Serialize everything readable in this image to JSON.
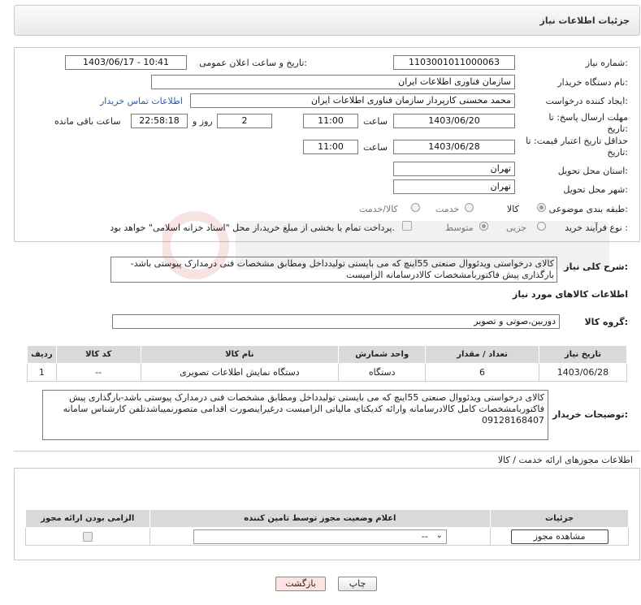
{
  "header": {
    "title": "جزئیات اطلاعات نیاز"
  },
  "form": {
    "need_number_label": "شماره نیاز:",
    "need_number": "1103001011000063",
    "announce_label": "تاریخ و ساعت اعلان عمومی:",
    "announce_value": "1403/06/17 - 10:41",
    "buyer_label": "نام دستگاه خریدار:",
    "buyer_value": "سازمان فناوری اطلاعات ایران",
    "creator_label": "ایجاد کننده درخواست:",
    "creator_value": "محمد محسنی کارپرداز سازمان فناوری اطلاعات ایران",
    "contact_link": "اطلاعات تماس خریدار",
    "deadline_label_1": "مهلت ارسال پاسخ: تا",
    "deadline_label_2": "تاریخ:",
    "deadline_date": "1403/06/20",
    "hour_label": "ساعت",
    "deadline_time": "11:00",
    "days_value": "2",
    "days_label": "روز و",
    "remaining_time": "22:58:18",
    "remaining_label": "ساعت باقی مانده",
    "validity_label_1": "حداقل تاریخ اعتبار قیمت: تا",
    "validity_label_2": "تاریخ:",
    "validity_date": "1403/06/28",
    "validity_time": "11:00",
    "province_label": "استان محل تحویل:",
    "province_value": "تهران",
    "city_label": "شهر محل تحویل:",
    "city_value": "تهران",
    "category_label": "طبقه بندی موضوعی:",
    "category_options": [
      "کالا",
      "خدمت",
      "کالا/خدمت"
    ],
    "process_label": "نوع فرآیند خرید :",
    "process_options": [
      "جزیی",
      "متوسط"
    ],
    "payment_note": "پرداخت تمام یا بخشی از مبلغ خرید،از محل \"اسناد خزانه اسلامی\" خواهد بود."
  },
  "description": {
    "label": "شرح کلی نیاز:",
    "text": "کالای درخواستی ویدئووال صنعتی 55اینچ که می بایستی تولیدداخل ومطابق مشخصات فنی درمدارک پیوستی باشد-بارگذاری پیش فاکتوربامشخصات کالادرسامانه الزامیست"
  },
  "goods": {
    "section_title": "اطلاعات کالاهای مورد نیاز",
    "group_label": "گروه کالا:",
    "group_value": "دوربین،صوتی و تصویر",
    "columns": [
      "ردیف",
      "کد کالا",
      "نام کالا",
      "واحد شمارش",
      "تعداد / مقدار",
      "تاریخ نیاز"
    ],
    "rows": [
      {
        "index": "1",
        "code": "--",
        "name": "دستگاه نمایش اطلاعات تصویری",
        "unit": "دستگاه",
        "qty": "6",
        "date": "1403/06/28"
      }
    ]
  },
  "buyer_notes": {
    "label": "توضیحات خریدار:",
    "text": "کالای درخواستی ویدئووال صنعتی 55اینچ که می بایستی تولیدداخل ومطابق مشخصات فنی درمدارک پیوستی باشد-بارگذاری پیش فاکتوربامشخصات کامل کالادرسامانه وارائه کدیکتای مالیاتی الزامیست درغیراینصورت اقدامی متصورنمیباشدتلفن کارشناس سامانه 09128168407"
  },
  "permits": {
    "section_title": "اطلاعات مجوزهای ارائه خدمت / کالا",
    "columns": [
      "الزامی بودن ارائه مجوز",
      "اعلام وضعیت مجوز توسط تامین کننده",
      "جزئیات"
    ],
    "select_value": "--",
    "view_button": "مشاهده مجوز"
  },
  "buttons": {
    "print": "چاپ",
    "back": "بازگشت"
  },
  "colors": {
    "link": "#2a5db0",
    "header_bg": "#eeeeee",
    "table_header": "#d9d9d9",
    "back_button_bg": "#fde3e3"
  }
}
